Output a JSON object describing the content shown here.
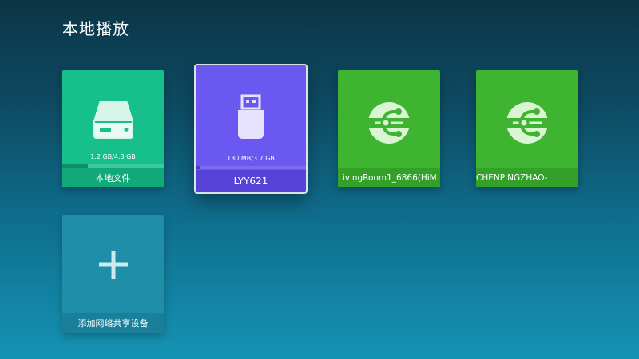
{
  "header": {
    "title": "本地播放"
  },
  "tiles": [
    {
      "label": "本地文件",
      "capacity": "1.2 GB/4.8 GB",
      "used_fraction": 0.25,
      "icon": "hard-drive-icon",
      "color": "#17c08a"
    },
    {
      "label": "LYY621",
      "capacity": "130 MB/3.7 GB",
      "used_fraction": 0.034,
      "icon": "usb-drive-icon",
      "color": "#6b58f1",
      "focused": true
    },
    {
      "label": "LivingRoom1_6866(HiM",
      "icon": "network-share-icon",
      "color": "#3eb431"
    },
    {
      "label": "CHENPINGZHAO-",
      "icon": "network-share-icon",
      "color": "#3eb431"
    },
    {
      "label": "添加网络共享设备",
      "icon": "plus-icon",
      "color": "#1e8ea9"
    }
  ]
}
